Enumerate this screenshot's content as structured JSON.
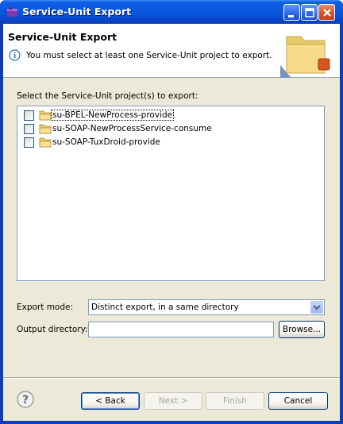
{
  "window": {
    "title": "Service-Unit Export"
  },
  "header": {
    "title": "Service-Unit Export",
    "message": "You must select at least one Service-Unit project to export.",
    "info_icon": "info-icon"
  },
  "projects": {
    "label": "Select the Service-Unit project(s) to export:",
    "items": [
      {
        "label": "su-BPEL-NewProcess-provide",
        "checked": false
      },
      {
        "label": "su-SOAP-NewProcessService-consume",
        "checked": false
      },
      {
        "label": "su-SOAP-TuxDroid-provide",
        "checked": false
      }
    ]
  },
  "export_mode": {
    "label": "Export mode:",
    "value": "Distinct export, in a same directory"
  },
  "output_directory": {
    "label": "Output directory:",
    "value": "",
    "browse_label": "Browse..."
  },
  "buttons": {
    "back": "< Back",
    "next": "Next >",
    "finish": "Finish",
    "cancel": "Cancel"
  },
  "colors": {
    "titlebar": "#0a55dd",
    "dialog_bg": "#ece9d8",
    "close_button": "#d6542d"
  }
}
